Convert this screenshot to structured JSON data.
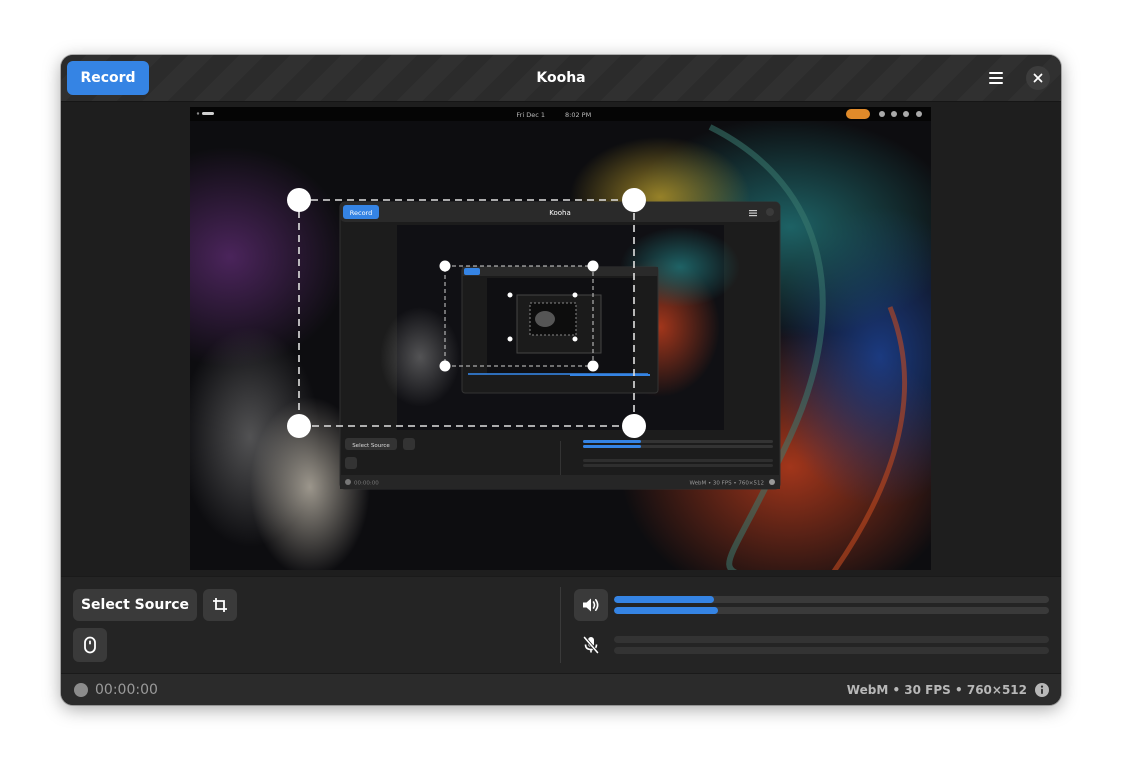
{
  "window": {
    "title": "Kooha",
    "record_label": "Record",
    "menu_icon": "hamburger-menu-icon",
    "close_icon": "close-icon"
  },
  "desktop_preview": {
    "top_bar_date": "Fri Dec 1",
    "top_bar_time": "8:02 PM",
    "nested_window_title": "Kooha",
    "nested_record_label": "Record",
    "nested_select_source": "Select Source",
    "nested_status_time": "00:00:00",
    "nested_status_info": "WebM • 30 FPS • 760×512"
  },
  "controls": {
    "select_source_label": "Select Source",
    "crop_icon": "crop-icon",
    "pointer_icon": "mouse-icon",
    "speaker_icon": "speaker-icon",
    "mic_icon": "microphone-muted-icon",
    "speaker_levels": [
      0.23,
      0.24
    ],
    "mic_levels": [
      0,
      0
    ]
  },
  "status": {
    "time": "00:00:00",
    "info": "WebM • 30 FPS • 760×512",
    "info_icon": "info-icon"
  },
  "colors": {
    "accent": "#3584e4",
    "window_bg": "#1e1e1e"
  }
}
